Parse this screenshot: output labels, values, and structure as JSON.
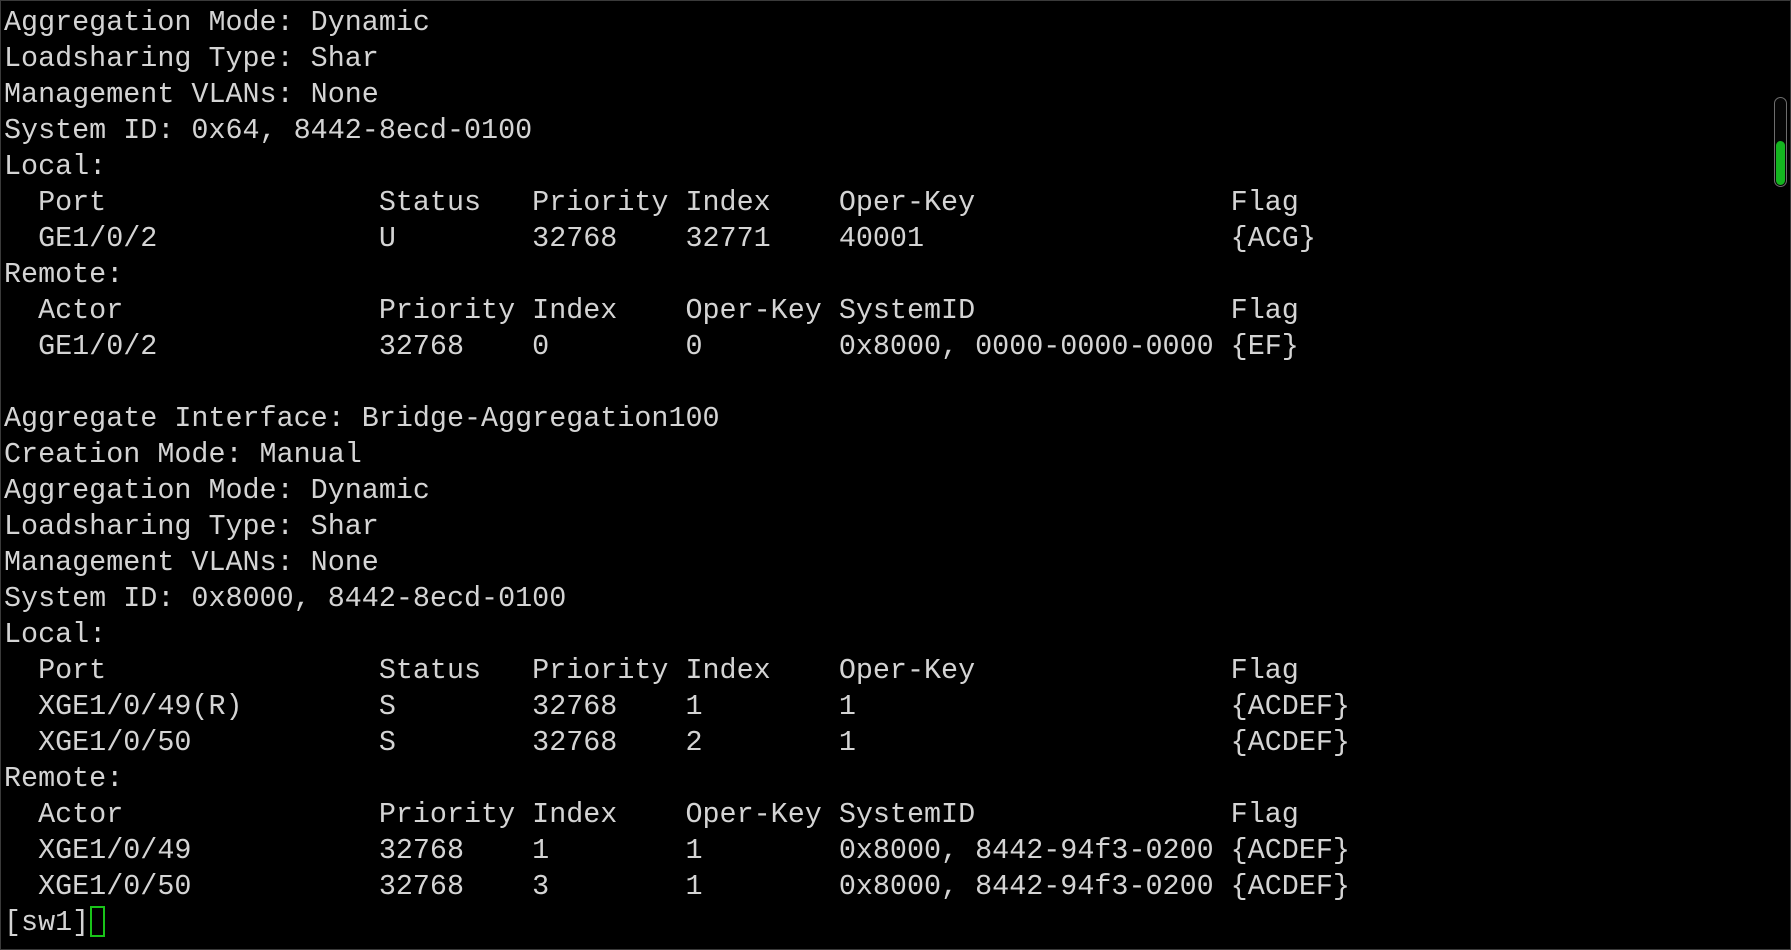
{
  "terminal": {
    "lines": [
      "Aggregation Mode: Dynamic",
      "Loadsharing Type: Shar",
      "Management VLANs: None",
      "System ID: 0x64, 8442-8ecd-0100",
      "Local:",
      "  Port                Status   Priority Index    Oper-Key               Flag",
      "  GE1/0/2             U        32768    32771    40001                  {ACG}",
      "Remote:",
      "  Actor               Priority Index    Oper-Key SystemID               Flag",
      "  GE1/0/2             32768    0        0        0x8000, 0000-0000-0000 {EF}",
      "",
      "Aggregate Interface: Bridge-Aggregation100",
      "Creation Mode: Manual",
      "Aggregation Mode: Dynamic",
      "Loadsharing Type: Shar",
      "Management VLANs: None",
      "System ID: 0x8000, 8442-8ecd-0100",
      "Local:",
      "  Port                Status   Priority Index    Oper-Key               Flag",
      "  XGE1/0/49(R)        S        32768    1        1                      {ACDEF}",
      "  XGE1/0/50           S        32768    2        1                      {ACDEF}",
      "Remote:",
      "  Actor               Priority Index    Oper-Key SystemID               Flag",
      "  XGE1/0/49           32768    1        1        0x8000, 8442-94f3-0200 {ACDEF}",
      "  XGE1/0/50           32768    3        1        0x8000, 8442-94f3-0200 {ACDEF}"
    ],
    "prompt": "[sw1]",
    "cursor_color": "#19c419"
  },
  "scrollbar": {
    "thumb_color": "#14b51f",
    "position_fraction": 1.0
  }
}
